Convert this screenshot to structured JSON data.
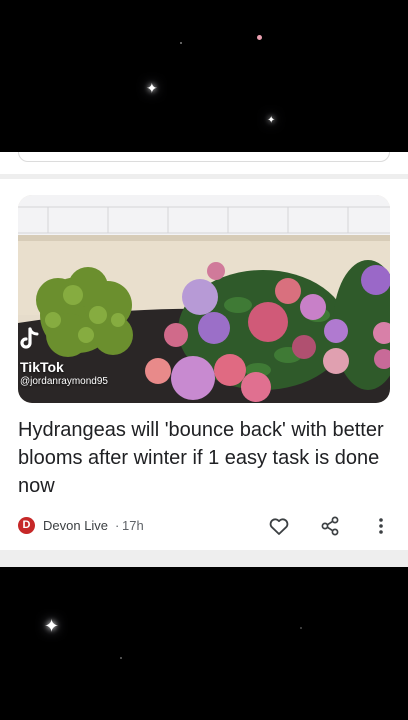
{
  "background": {
    "color": "#000000"
  },
  "article": {
    "headline": "Hydrangeas will 'bounce back' with better blooms after winter if 1 easy task is done now",
    "thumbnail": {
      "watermark_brand": "TikTok",
      "watermark_user": "@jordanraymond95",
      "logo_icon": "tiktok-logo-icon"
    },
    "source": {
      "initial": "D",
      "name": "Devon Live",
      "separator": "·",
      "age": "17h",
      "icon_color": "#c62828"
    },
    "actions": {
      "like_icon": "heart-icon",
      "share_icon": "share-icon",
      "more_icon": "more-vert-icon"
    }
  }
}
